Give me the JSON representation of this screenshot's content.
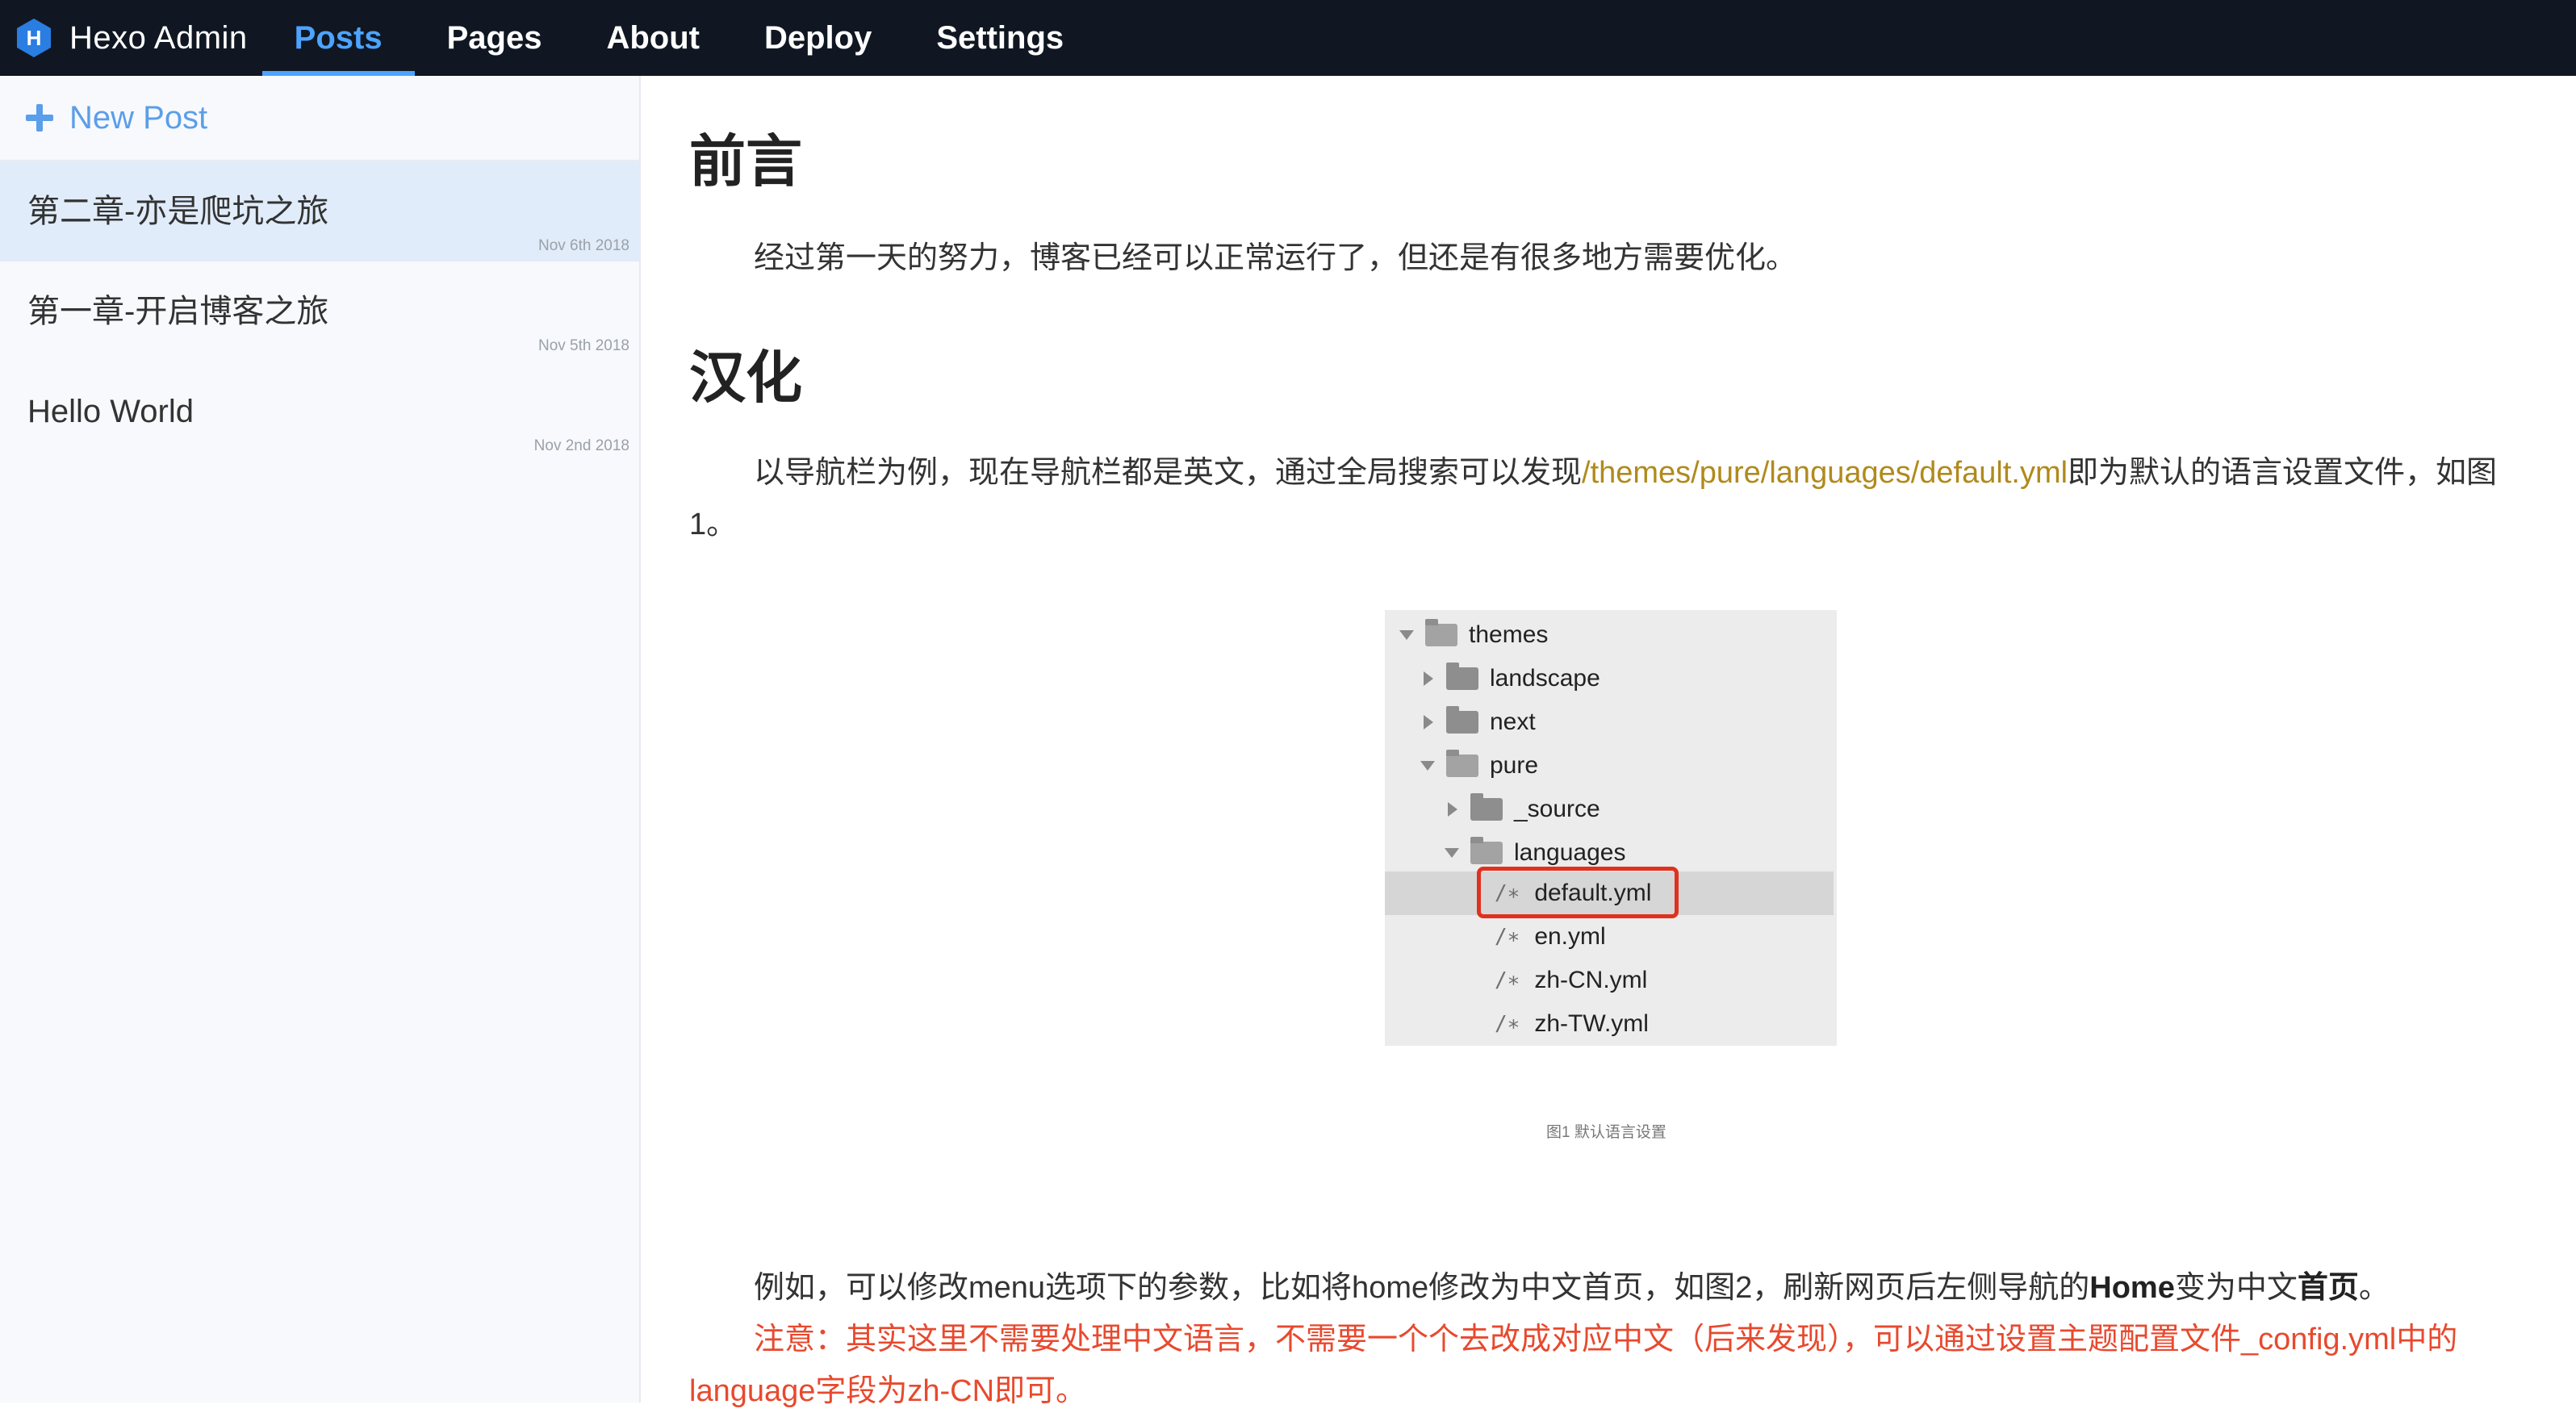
{
  "app": {
    "brand_name": "Hexo Admin",
    "brand_icon": "hexo-logo-icon",
    "accent_color": "#4da3ff"
  },
  "nav": {
    "items": [
      {
        "label": "Posts",
        "active": true
      },
      {
        "label": "Pages",
        "active": false
      },
      {
        "label": "About",
        "active": false
      },
      {
        "label": "Deploy",
        "active": false
      },
      {
        "label": "Settings",
        "active": false
      }
    ]
  },
  "sidebar": {
    "new_post_label": "New Post",
    "new_post_icon": "plus-icon",
    "posts": [
      {
        "title": "第二章-亦是爬坑之旅",
        "date": "Nov 6th 2018",
        "selected": true
      },
      {
        "title": "第一章-开启博客之旅",
        "date": "Nov 5th 2018",
        "selected": false
      },
      {
        "title": "Hello World",
        "date": "Nov 2nd 2018",
        "selected": false
      }
    ]
  },
  "article": {
    "heading_1": "前言",
    "para_1": "经过第一天的努力，博客已经可以正常运行了，但还是有很多地方需要优化。",
    "heading_2": "汉化",
    "para_2_a": "以导航栏为例，现在导航栏都是英文，通过全局搜索可以发现",
    "para_2_link": "/themes/pure/languages/default.yml",
    "para_2_b": "即为默认的语言设置文件，如图1。",
    "figure": {
      "tree": [
        {
          "label": "themes",
          "type": "folder",
          "expanded": true,
          "depth": 0
        },
        {
          "label": "landscape",
          "type": "folder",
          "expanded": false,
          "depth": 1
        },
        {
          "label": "next",
          "type": "folder",
          "expanded": false,
          "depth": 1
        },
        {
          "label": "pure",
          "type": "folder",
          "expanded": true,
          "depth": 1
        },
        {
          "label": "_source",
          "type": "folder",
          "expanded": false,
          "depth": 2
        },
        {
          "label": "languages",
          "type": "folder",
          "expanded": true,
          "depth": 2
        },
        {
          "label": "default.yml",
          "type": "file",
          "depth": 3,
          "highlighted": true
        },
        {
          "label": "en.yml",
          "type": "file",
          "depth": 3
        },
        {
          "label": "zh-CN.yml",
          "type": "file",
          "depth": 3
        },
        {
          "label": "zh-TW.yml",
          "type": "file",
          "depth": 3
        }
      ],
      "file_glyph": "/∗",
      "highlight_color": "#e0311f",
      "caption": "图1 默认语言设置"
    },
    "para_3_a": "例如，可以修改menu选项下的参数，比如将home修改为中文首页，如图2，刷新网页后左侧导航的",
    "para_3_bold_1": "Home",
    "para_3_b": "变为中文",
    "para_3_bold_2": "首页",
    "para_3_c": "。",
    "note": "注意：其实这里不需要处理中文语言，不需要一个个去改成对应中文（后来发现），可以通过设置主题配置文件_config.yml中的language字段为zh-CN即可。",
    "note_color": "#e8492e",
    "link_color": "#b08a1c"
  }
}
